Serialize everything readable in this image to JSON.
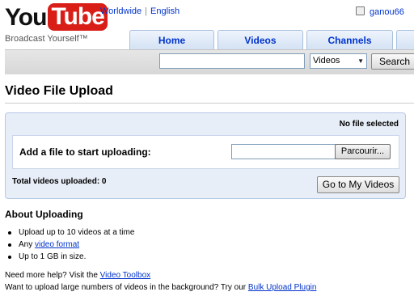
{
  "logo": {
    "you": "You",
    "tube": "Tube",
    "tagline": "Broadcast Yourself™"
  },
  "top_links": {
    "worldwide": "Worldwide",
    "separator": "|",
    "english": "English"
  },
  "user": {
    "name": "ganou66"
  },
  "tabs": [
    {
      "label": "Home"
    },
    {
      "label": "Videos"
    },
    {
      "label": "Channels"
    }
  ],
  "search": {
    "value": "",
    "category": "Videos",
    "button_label": "Search"
  },
  "page": {
    "title": "Video File Upload"
  },
  "upload": {
    "status": "No file selected",
    "prompt": "Add a file to start uploading:",
    "browse_label": "Parcourir...",
    "total_label": "Total videos uploaded: 0",
    "my_videos_label": "Go to My Videos"
  },
  "about": {
    "heading": "About Uploading",
    "items": [
      {
        "text": "Upload up to 10 videos at a time"
      },
      {
        "prefix": "Any ",
        "link": "video format"
      },
      {
        "text": "Up to 1 GB in size."
      }
    ]
  },
  "help": {
    "line1_text": "Need more help? Visit the ",
    "line1_link": "Video Toolbox",
    "line2_text": "Want to upload large numbers of videos in the background? Try our ",
    "line2_link": "Bulk Upload Plugin"
  },
  "colors": {
    "link": "#0033cc",
    "brand_red": "#d91e18",
    "tab_text": "#0033cc",
    "upload_panel": "#e8eef8"
  }
}
